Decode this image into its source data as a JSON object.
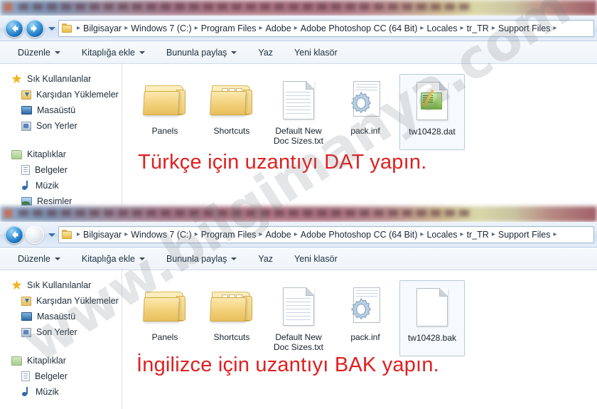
{
  "window_top": {
    "blurred_titlebar": true,
    "nav": {
      "back_label": "Geri",
      "forward_label": "İleri",
      "back_enabled": true,
      "forward_enabled": true,
      "history_label": "Son konumlar"
    },
    "breadcrumb": {
      "folder_icon": "folder-icon",
      "items": [
        "Bilgisayar",
        "Windows 7 (C:)",
        "Program Files",
        "Adobe",
        "Adobe Photoshop CC (64 Bit)",
        "Locales",
        "tr_TR",
        "Support Files"
      ],
      "trailing_separator": "▸"
    },
    "toolbar": [
      {
        "label": "Düzenle",
        "caret": true
      },
      {
        "label": "Kitaplığa ekle",
        "caret": true
      },
      {
        "label": "Bununla paylaş",
        "caret": true
      },
      {
        "label": "Yaz",
        "caret": false
      },
      {
        "label": "Yeni klasör",
        "caret": false
      }
    ],
    "sidebar": {
      "groups": [
        {
          "header": {
            "label": "Sık Kullanılanlar",
            "icon": "star-icon"
          },
          "items": [
            {
              "label": "Karşıdan Yüklemeler",
              "icon": "downloads-icon"
            },
            {
              "label": "Masaüstü",
              "icon": "desktop-icon"
            },
            {
              "label": "Son Yerler",
              "icon": "recent-places-icon"
            }
          ]
        },
        {
          "header": {
            "label": "Kitaplıklar",
            "icon": "libraries-icon"
          },
          "items": [
            {
              "label": "Belgeler",
              "icon": "documents-icon"
            },
            {
              "label": "Müzik",
              "icon": "music-icon"
            },
            {
              "label": "Resimler",
              "icon": "pictures-icon"
            }
          ]
        }
      ]
    },
    "files": [
      {
        "name": "Panels",
        "type": "folder",
        "selected": false
      },
      {
        "name": "Shortcuts",
        "type": "folder-multi",
        "selected": false
      },
      {
        "name": "Default New Doc Sizes.txt",
        "type": "text-document",
        "selected": false
      },
      {
        "name": "pack.inf",
        "type": "inf-gear-document",
        "selected": false
      },
      {
        "name": "tw10428.dat",
        "type": "dat-thumbnail-document",
        "selected": true
      }
    ],
    "caption": "Türkçe için uzantıyı DAT yapın."
  },
  "window_bottom": {
    "blurred_titlebar": true,
    "nav": {
      "back_label": "Geri",
      "forward_label": "İleri",
      "back_enabled": true,
      "forward_enabled": false,
      "history_label": "Son konumlar"
    },
    "breadcrumb": {
      "folder_icon": "folder-icon",
      "items": [
        "Bilgisayar",
        "Windows 7 (C:)",
        "Program Files",
        "Adobe",
        "Adobe Photoshop CC (64 Bit)",
        "Locales",
        "tr_TR",
        "Support Files"
      ],
      "trailing_separator": "▸"
    },
    "toolbar": [
      {
        "label": "Düzenle",
        "caret": true
      },
      {
        "label": "Kitaplığa ekle",
        "caret": true
      },
      {
        "label": "Bununla paylaş",
        "caret": true
      },
      {
        "label": "Yaz",
        "caret": false
      },
      {
        "label": "Yeni klasör",
        "caret": false
      }
    ],
    "sidebar": {
      "groups": [
        {
          "header": {
            "label": "Sık Kullanılanlar",
            "icon": "star-icon"
          },
          "items": [
            {
              "label": "Karşıdan Yüklemeler",
              "icon": "downloads-icon"
            },
            {
              "label": "Masaüstü",
              "icon": "desktop-icon"
            },
            {
              "label": "Son Yerler",
              "icon": "recent-places-icon"
            }
          ]
        },
        {
          "header": {
            "label": "Kitaplıklar",
            "icon": "libraries-icon"
          },
          "items": [
            {
              "label": "Belgeler",
              "icon": "documents-icon"
            },
            {
              "label": "Müzik",
              "icon": "music-icon"
            }
          ]
        }
      ]
    },
    "files": [
      {
        "name": "Panels",
        "type": "folder",
        "selected": false
      },
      {
        "name": "Shortcuts",
        "type": "folder-multi",
        "selected": false
      },
      {
        "name": "Default New Doc Sizes.txt",
        "type": "text-document",
        "selected": false
      },
      {
        "name": "pack.inf",
        "type": "inf-gear-document",
        "selected": false
      },
      {
        "name": "tw10428.bak",
        "type": "blank-document",
        "selected": true
      }
    ],
    "caption": "İngilizce için uzantıyı BAK yapın."
  },
  "watermark": {
    "text": "www.bilgimanya.com"
  },
  "colors": {
    "caption_red": "#e02020",
    "folder_yellow": "#f2d079",
    "nav_blue": "#1a6fb8",
    "selection_border": "#b8c9dc"
  }
}
